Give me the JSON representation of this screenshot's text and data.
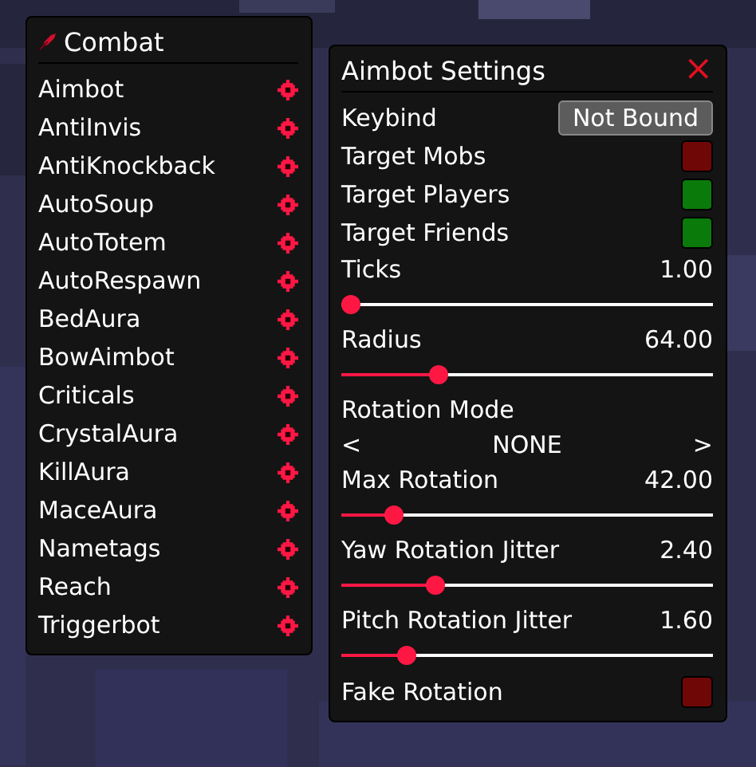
{
  "category_panel": {
    "title": "Combat",
    "modules": [
      {
        "name": "Aimbot"
      },
      {
        "name": "AntiInvis"
      },
      {
        "name": "AntiKnockback"
      },
      {
        "name": "AutoSoup"
      },
      {
        "name": "AutoTotem"
      },
      {
        "name": "AutoRespawn"
      },
      {
        "name": "BedAura"
      },
      {
        "name": "BowAimbot"
      },
      {
        "name": "Criticals"
      },
      {
        "name": "CrystalAura"
      },
      {
        "name": "KillAura"
      },
      {
        "name": "MaceAura"
      },
      {
        "name": "Nametags"
      },
      {
        "name": "Reach"
      },
      {
        "name": "Triggerbot"
      }
    ]
  },
  "settings_panel": {
    "title": "Aimbot Settings",
    "close": "×",
    "settings": [
      {
        "kind": "keybind",
        "label": "Keybind",
        "value": "Not Bound"
      },
      {
        "kind": "toggle",
        "label": "Target Mobs",
        "checked": false
      },
      {
        "kind": "toggle",
        "label": "Target Players",
        "checked": true
      },
      {
        "kind": "toggle",
        "label": "Target Friends",
        "checked": true
      },
      {
        "kind": "slider",
        "label": "Ticks",
        "reading": "1.00",
        "level": 0
      },
      {
        "kind": "slider",
        "label": "Radius",
        "reading": "64.00",
        "level": 0.25
      },
      {
        "kind": "mode",
        "label": "Rotation Mode",
        "prev": "<",
        "value": "NONE",
        "next": ">"
      },
      {
        "kind": "slider",
        "label": "Max Rotation",
        "reading": "42.00",
        "level": 0.12
      },
      {
        "kind": "slider",
        "label": "Yaw Rotation Jitter",
        "reading": "2.40",
        "level": 0.24
      },
      {
        "kind": "slider",
        "label": "Pitch Rotation Jitter",
        "reading": "1.60",
        "level": 0.16
      },
      {
        "kind": "toggle",
        "label": "Fake Rotation",
        "checked": false
      }
    ]
  }
}
